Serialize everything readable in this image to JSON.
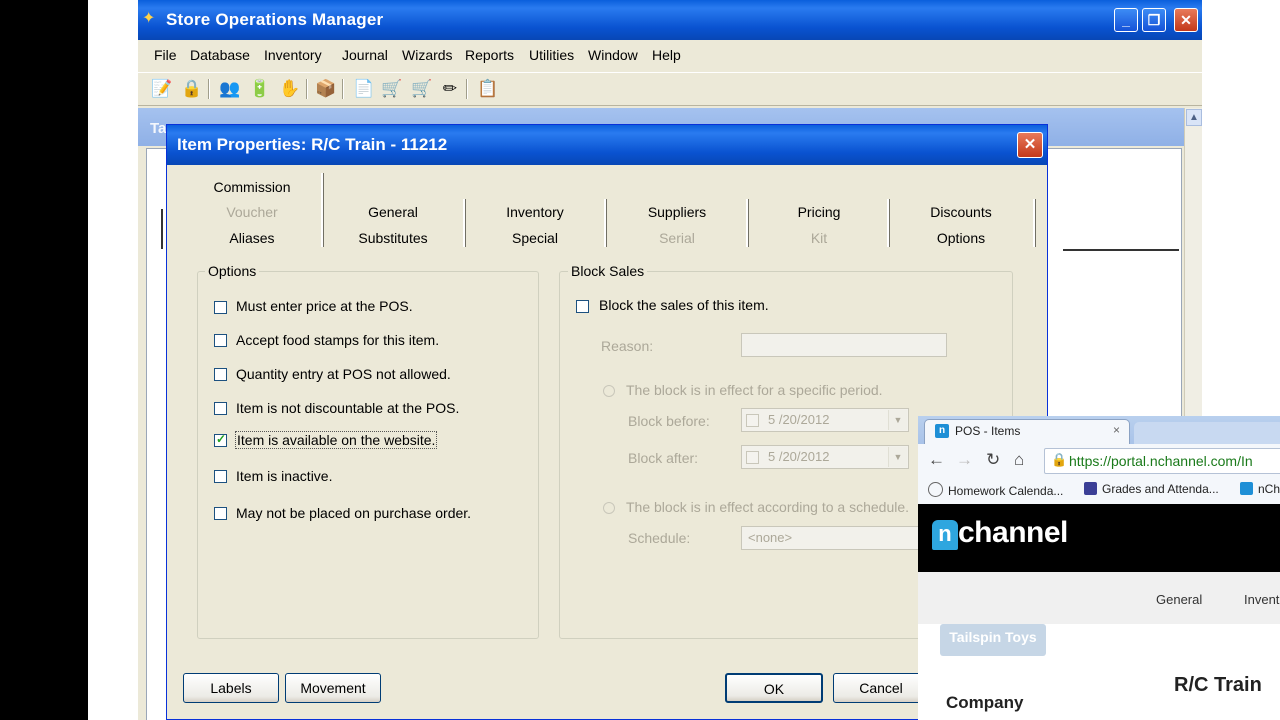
{
  "main_window": {
    "title": "Store Operations Manager",
    "controls": {
      "minimize": "_",
      "maximize": "❐",
      "close": "✕"
    },
    "menu": [
      "File",
      "Database",
      "Inventory",
      "Journal",
      "Wizards",
      "Reports",
      "Utilities",
      "Window",
      "Help"
    ],
    "toolbar_icons": [
      "export-icon",
      "lock-icon",
      "users-icon",
      "battery-icon",
      "hand-icon",
      "box-icon",
      "document-icon",
      "cart-in-icon",
      "cart-out-icon",
      "pencil-icon",
      "clipboard-icon"
    ],
    "child_title": "Ta"
  },
  "dialog": {
    "title": "Item Properties: R/C Train - 11212",
    "close": "✕",
    "tabs": {
      "commission": "Commission",
      "voucher": "Voucher",
      "aliases": "Aliases",
      "general": "General",
      "substitutes": "Substitutes",
      "inventory": "Inventory",
      "special": "Special",
      "suppliers": "Suppliers",
      "serial": "Serial",
      "pricing": "Pricing",
      "kit": "Kit",
      "discounts": "Discounts",
      "options": "Options"
    },
    "options_group": {
      "label": "Options",
      "items": [
        {
          "label": "Must enter price at the POS.",
          "checked": false
        },
        {
          "label": "Accept food stamps for this item.",
          "checked": false
        },
        {
          "label": "Quantity entry at POS not allowed.",
          "checked": false
        },
        {
          "label": "Item is not discountable at the POS.",
          "checked": false
        },
        {
          "label": "Item is available on the website.",
          "checked": true
        },
        {
          "label": "Item is inactive.",
          "checked": false
        },
        {
          "label": "May not be placed on purchase order.",
          "checked": false
        }
      ]
    },
    "block_group": {
      "label": "Block Sales",
      "block_checkbox": "Block the sales of this item.",
      "reason_label": "Reason:",
      "reason_value": "",
      "radio_period": "The block is in effect for a specific period.",
      "block_before_label": "Block before:",
      "block_before_value": "5 /20/2012",
      "block_after_label": "Block after:",
      "block_after_value": "5 /20/2012",
      "radio_schedule": "The block is in effect according to a schedule.",
      "schedule_label": "Schedule:",
      "schedule_value": "<none>"
    },
    "buttons": {
      "labels": "Labels",
      "movement": "Movement",
      "ok": "OK",
      "cancel": "Cancel"
    }
  },
  "browser": {
    "tab_title": "POS - Items",
    "tab_close": "×",
    "url": "https://portal.nchannel.com/In",
    "bookmarks": [
      "Homework Calenda...",
      "Grades and Attenda...",
      "nCh"
    ],
    "logo_n": "n",
    "logo_text": "channel",
    "nav": [
      "General",
      "Invent"
    ],
    "tag": "Tailspin Toys",
    "company_label": "Company",
    "item_title": "R/C Train"
  }
}
